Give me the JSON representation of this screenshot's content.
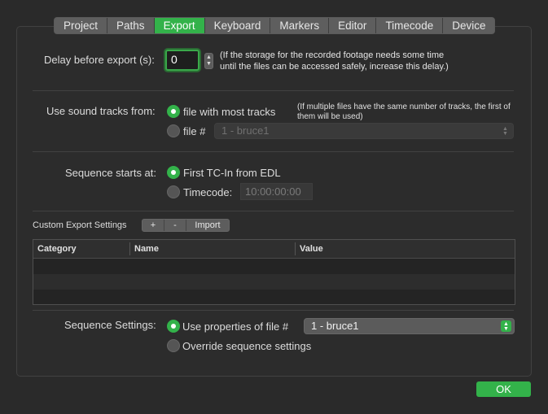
{
  "tabs": [
    "Project",
    "Paths",
    "Export",
    "Keyboard",
    "Markers",
    "Editor",
    "Timecode",
    "Device"
  ],
  "active_tab": "Export",
  "delay": {
    "label": "Delay before export (s):",
    "value": "0",
    "note_line1": "(If the storage for the recorded footage needs some time",
    "note_line2": "until the files can be accessed safely, increase this delay.)"
  },
  "sound_tracks": {
    "label": "Use sound tracks from:",
    "option_most": "file with most tracks",
    "note_line1": "(If multiple files have the same number of tracks, the first of",
    "note_line2": "them will be used)",
    "option_file": "file #",
    "file_select_value": "1 - bruce1",
    "selected": "file with most tracks"
  },
  "sequence_start": {
    "label": "Sequence starts at:",
    "option_edl": "First TC-In from EDL",
    "option_tc": "Timecode:",
    "timecode_value": "10:00:00:00",
    "selected": "First TC-In from EDL"
  },
  "custom_export": {
    "label": "Custom Export Settings",
    "add_label": "+",
    "remove_label": "-",
    "import_label": "Import",
    "columns": [
      "Category",
      "Name",
      "Value"
    ],
    "rows": []
  },
  "sequence_settings": {
    "label": "Sequence Settings:",
    "option_use": "Use properties of file #",
    "file_select_value": "1 - bruce1",
    "option_override": "Override sequence settings",
    "selected": "Use properties of file #"
  },
  "ok_label": "OK",
  "colors": {
    "accent": "#33b24a",
    "background": "#2a2a2a"
  }
}
